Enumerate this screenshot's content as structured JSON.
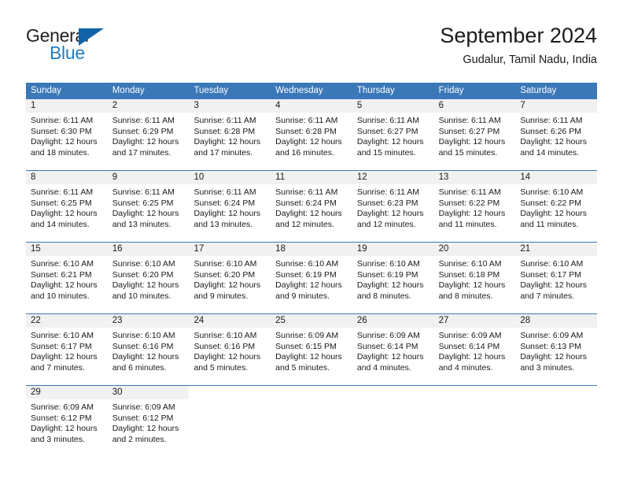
{
  "brand": {
    "name_part1": "General",
    "name_part2": "Blue",
    "triangle_icon": "blue-triangle-icon",
    "colors": {
      "general_text": "#231f20",
      "blue_text": "#1f7ec4",
      "triangle": "#1263a8"
    }
  },
  "header": {
    "title": "September 2024",
    "subtitle": "Gudalur, Tamil Nadu, India"
  },
  "theme": {
    "header_row_bg": "#3a78b8",
    "header_row_text": "#ffffff",
    "day_number_bg": "#f1f1f1",
    "cell_bg": "#ffffff",
    "rule_color": "#3a78b8"
  },
  "weekdays": [
    "Sunday",
    "Monday",
    "Tuesday",
    "Wednesday",
    "Thursday",
    "Friday",
    "Saturday"
  ],
  "weeks": [
    [
      {
        "day": "1",
        "sunrise": "Sunrise: 6:11 AM",
        "sunset": "Sunset: 6:30 PM",
        "daylight_line1": "Daylight: 12 hours",
        "daylight_line2": "and 18 minutes."
      },
      {
        "day": "2",
        "sunrise": "Sunrise: 6:11 AM",
        "sunset": "Sunset: 6:29 PM",
        "daylight_line1": "Daylight: 12 hours",
        "daylight_line2": "and 17 minutes."
      },
      {
        "day": "3",
        "sunrise": "Sunrise: 6:11 AM",
        "sunset": "Sunset: 6:28 PM",
        "daylight_line1": "Daylight: 12 hours",
        "daylight_line2": "and 17 minutes."
      },
      {
        "day": "4",
        "sunrise": "Sunrise: 6:11 AM",
        "sunset": "Sunset: 6:28 PM",
        "daylight_line1": "Daylight: 12 hours",
        "daylight_line2": "and 16 minutes."
      },
      {
        "day": "5",
        "sunrise": "Sunrise: 6:11 AM",
        "sunset": "Sunset: 6:27 PM",
        "daylight_line1": "Daylight: 12 hours",
        "daylight_line2": "and 15 minutes."
      },
      {
        "day": "6",
        "sunrise": "Sunrise: 6:11 AM",
        "sunset": "Sunset: 6:27 PM",
        "daylight_line1": "Daylight: 12 hours",
        "daylight_line2": "and 15 minutes."
      },
      {
        "day": "7",
        "sunrise": "Sunrise: 6:11 AM",
        "sunset": "Sunset: 6:26 PM",
        "daylight_line1": "Daylight: 12 hours",
        "daylight_line2": "and 14 minutes."
      }
    ],
    [
      {
        "day": "8",
        "sunrise": "Sunrise: 6:11 AM",
        "sunset": "Sunset: 6:25 PM",
        "daylight_line1": "Daylight: 12 hours",
        "daylight_line2": "and 14 minutes."
      },
      {
        "day": "9",
        "sunrise": "Sunrise: 6:11 AM",
        "sunset": "Sunset: 6:25 PM",
        "daylight_line1": "Daylight: 12 hours",
        "daylight_line2": "and 13 minutes."
      },
      {
        "day": "10",
        "sunrise": "Sunrise: 6:11 AM",
        "sunset": "Sunset: 6:24 PM",
        "daylight_line1": "Daylight: 12 hours",
        "daylight_line2": "and 13 minutes."
      },
      {
        "day": "11",
        "sunrise": "Sunrise: 6:11 AM",
        "sunset": "Sunset: 6:24 PM",
        "daylight_line1": "Daylight: 12 hours",
        "daylight_line2": "and 12 minutes."
      },
      {
        "day": "12",
        "sunrise": "Sunrise: 6:11 AM",
        "sunset": "Sunset: 6:23 PM",
        "daylight_line1": "Daylight: 12 hours",
        "daylight_line2": "and 12 minutes."
      },
      {
        "day": "13",
        "sunrise": "Sunrise: 6:11 AM",
        "sunset": "Sunset: 6:22 PM",
        "daylight_line1": "Daylight: 12 hours",
        "daylight_line2": "and 11 minutes."
      },
      {
        "day": "14",
        "sunrise": "Sunrise: 6:10 AM",
        "sunset": "Sunset: 6:22 PM",
        "daylight_line1": "Daylight: 12 hours",
        "daylight_line2": "and 11 minutes."
      }
    ],
    [
      {
        "day": "15",
        "sunrise": "Sunrise: 6:10 AM",
        "sunset": "Sunset: 6:21 PM",
        "daylight_line1": "Daylight: 12 hours",
        "daylight_line2": "and 10 minutes."
      },
      {
        "day": "16",
        "sunrise": "Sunrise: 6:10 AM",
        "sunset": "Sunset: 6:20 PM",
        "daylight_line1": "Daylight: 12 hours",
        "daylight_line2": "and 10 minutes."
      },
      {
        "day": "17",
        "sunrise": "Sunrise: 6:10 AM",
        "sunset": "Sunset: 6:20 PM",
        "daylight_line1": "Daylight: 12 hours",
        "daylight_line2": "and 9 minutes."
      },
      {
        "day": "18",
        "sunrise": "Sunrise: 6:10 AM",
        "sunset": "Sunset: 6:19 PM",
        "daylight_line1": "Daylight: 12 hours",
        "daylight_line2": "and 9 minutes."
      },
      {
        "day": "19",
        "sunrise": "Sunrise: 6:10 AM",
        "sunset": "Sunset: 6:19 PM",
        "daylight_line1": "Daylight: 12 hours",
        "daylight_line2": "and 8 minutes."
      },
      {
        "day": "20",
        "sunrise": "Sunrise: 6:10 AM",
        "sunset": "Sunset: 6:18 PM",
        "daylight_line1": "Daylight: 12 hours",
        "daylight_line2": "and 8 minutes."
      },
      {
        "day": "21",
        "sunrise": "Sunrise: 6:10 AM",
        "sunset": "Sunset: 6:17 PM",
        "daylight_line1": "Daylight: 12 hours",
        "daylight_line2": "and 7 minutes."
      }
    ],
    [
      {
        "day": "22",
        "sunrise": "Sunrise: 6:10 AM",
        "sunset": "Sunset: 6:17 PM",
        "daylight_line1": "Daylight: 12 hours",
        "daylight_line2": "and 7 minutes."
      },
      {
        "day": "23",
        "sunrise": "Sunrise: 6:10 AM",
        "sunset": "Sunset: 6:16 PM",
        "daylight_line1": "Daylight: 12 hours",
        "daylight_line2": "and 6 minutes."
      },
      {
        "day": "24",
        "sunrise": "Sunrise: 6:10 AM",
        "sunset": "Sunset: 6:16 PM",
        "daylight_line1": "Daylight: 12 hours",
        "daylight_line2": "and 5 minutes."
      },
      {
        "day": "25",
        "sunrise": "Sunrise: 6:09 AM",
        "sunset": "Sunset: 6:15 PM",
        "daylight_line1": "Daylight: 12 hours",
        "daylight_line2": "and 5 minutes."
      },
      {
        "day": "26",
        "sunrise": "Sunrise: 6:09 AM",
        "sunset": "Sunset: 6:14 PM",
        "daylight_line1": "Daylight: 12 hours",
        "daylight_line2": "and 4 minutes."
      },
      {
        "day": "27",
        "sunrise": "Sunrise: 6:09 AM",
        "sunset": "Sunset: 6:14 PM",
        "daylight_line1": "Daylight: 12 hours",
        "daylight_line2": "and 4 minutes."
      },
      {
        "day": "28",
        "sunrise": "Sunrise: 6:09 AM",
        "sunset": "Sunset: 6:13 PM",
        "daylight_line1": "Daylight: 12 hours",
        "daylight_line2": "and 3 minutes."
      }
    ],
    [
      {
        "day": "29",
        "sunrise": "Sunrise: 6:09 AM",
        "sunset": "Sunset: 6:12 PM",
        "daylight_line1": "Daylight: 12 hours",
        "daylight_line2": "and 3 minutes."
      },
      {
        "day": "30",
        "sunrise": "Sunrise: 6:09 AM",
        "sunset": "Sunset: 6:12 PM",
        "daylight_line1": "Daylight: 12 hours",
        "daylight_line2": "and 2 minutes."
      },
      {
        "day": "",
        "sunrise": "",
        "sunset": "",
        "daylight_line1": "",
        "daylight_line2": ""
      },
      {
        "day": "",
        "sunrise": "",
        "sunset": "",
        "daylight_line1": "",
        "daylight_line2": ""
      },
      {
        "day": "",
        "sunrise": "",
        "sunset": "",
        "daylight_line1": "",
        "daylight_line2": ""
      },
      {
        "day": "",
        "sunrise": "",
        "sunset": "",
        "daylight_line1": "",
        "daylight_line2": ""
      },
      {
        "day": "",
        "sunrise": "",
        "sunset": "",
        "daylight_line1": "",
        "daylight_line2": ""
      }
    ]
  ]
}
